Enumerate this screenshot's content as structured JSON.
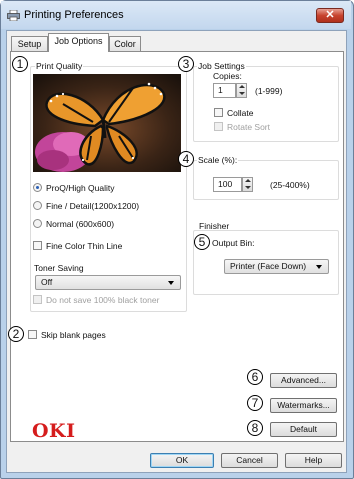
{
  "window": {
    "title": "Printing Preferences",
    "close_glyph": "✕",
    "icon": "printer-icon"
  },
  "tabs": [
    {
      "label": "Setup",
      "active": false
    },
    {
      "label": "Job Options",
      "active": true
    },
    {
      "label": "Color",
      "active": false
    }
  ],
  "callouts": [
    "1",
    "2",
    "3",
    "4",
    "5",
    "6",
    "7",
    "8"
  ],
  "print_quality": {
    "group_label": "Print Quality",
    "preview_image": "monarch-butterfly-photo",
    "options": [
      {
        "label": "ProQ/High Quality",
        "selected": true
      },
      {
        "label": "Fine / Detail(1200x1200)",
        "selected": false
      },
      {
        "label": "Normal (600x600)",
        "selected": false
      }
    ],
    "fine_color_thin_line": {
      "label": "Fine Color Thin Line",
      "checked": false
    },
    "toner_saving": {
      "label": "Toner Saving",
      "value": "Off"
    },
    "no_100_black": {
      "label": "Do not save 100% black toner",
      "checked": false,
      "enabled": false
    }
  },
  "skip_blank_pages": {
    "label": "Skip blank pages",
    "checked": false
  },
  "job_settings": {
    "group_label": "Job Settings",
    "copies_label": "Copies:",
    "copies_value": "1",
    "copies_range": "(1-999)",
    "collate": {
      "label": "Collate",
      "checked": false
    },
    "rotate_sort": {
      "label": "Rotate Sort",
      "checked": false,
      "enabled": false
    }
  },
  "scale": {
    "label": "Scale (%):",
    "value": "100",
    "range": "(25-400%)"
  },
  "finisher": {
    "group_label": "Finisher",
    "output_bin_label": "Output Bin:",
    "output_bin_value": "Printer (Face Down)"
  },
  "buttons": {
    "advanced": "Advanced...",
    "watermarks": "Watermarks...",
    "default": "Default",
    "ok": "OK",
    "cancel": "Cancel",
    "help": "Help"
  },
  "brand": {
    "logo_text": "OKI",
    "color": "#d51c1c"
  }
}
